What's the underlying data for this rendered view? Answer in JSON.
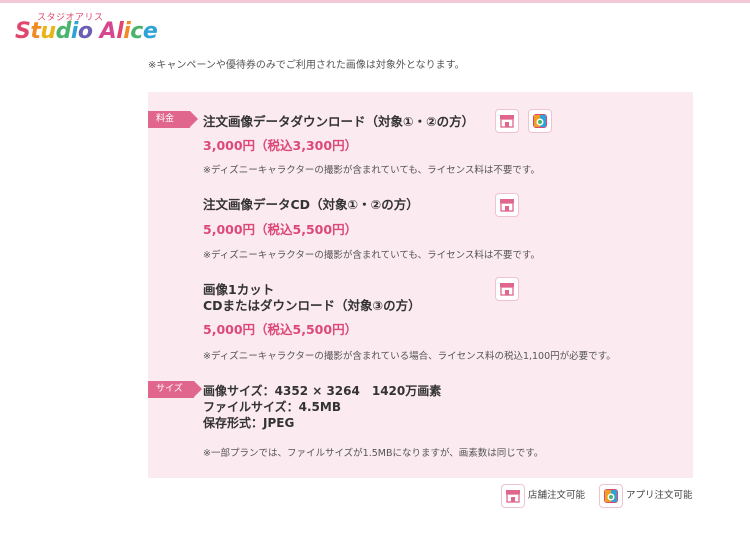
{
  "brand": {
    "small": "スタジオアリス",
    "main_chars": [
      "S",
      "t",
      "u",
      "d",
      "i",
      "o",
      " ",
      "A",
      "l",
      "i",
      "c",
      "e"
    ]
  },
  "notice": "※キャンペーンや優待券のみでご利用された画像は対象外となります。",
  "price_tag": "料金",
  "size_tag": "サイズ",
  "items": [
    {
      "title": "注文画像データダウンロード（対象①・②の方）",
      "price": "3,000円（税込3,300円）",
      "note": "※ディズニーキャラクターの撮影が含まれていても、ライセンス料は不要です。"
    },
    {
      "title": "注文画像データCD（対象①・②の方）",
      "price": "5,000円（税込5,500円）",
      "note": "※ディズニーキャラクターの撮影が含まれていても、ライセンス料は不要です。"
    },
    {
      "title_line1": "画像1カット",
      "title_line2": "CDまたはダウンロード（対象③の方）",
      "price": "5,000円（税込5,500円）",
      "note": "※ディズニーキャラクターの撮影が含まれている場合、ライセンス料の税込1,100円が必要です。"
    }
  ],
  "specs": {
    "image_size": "画像サイズ：4352 × 3264　1420万画素",
    "file_size": "ファイルサイズ：4.5MB",
    "format": "保存形式：JPEG",
    "note": "※一部プランでは、ファイルサイズが1.5MBになりますが、画素数は同じです。"
  },
  "legend": {
    "store": "店舗注文可能",
    "app": "アプリ注文可能"
  },
  "colors": {
    "accent": "#dc4978",
    "tag": "#e0668d",
    "panel": "#fbeaf0"
  }
}
